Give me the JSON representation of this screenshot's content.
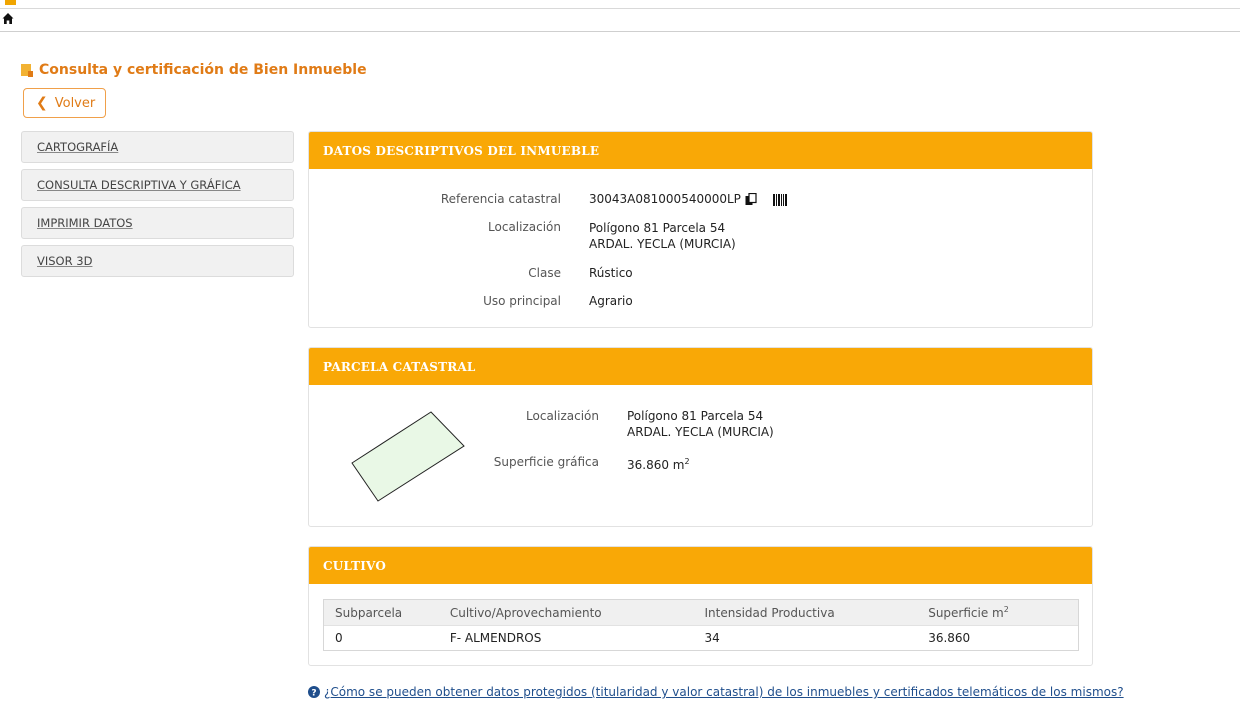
{
  "header": {
    "title": "Consulta y certificación de Bien Inmueble",
    "back_label": "Volver"
  },
  "sidebar": {
    "items": [
      {
        "label": "CARTOGRAFÍA"
      },
      {
        "label": "CONSULTA DESCRIPTIVA Y GRÁFICA"
      },
      {
        "label": "IMPRIMIR DATOS"
      },
      {
        "label": "VISOR 3D"
      }
    ]
  },
  "inmueble": {
    "heading": "DATOS DESCRIPTIVOS DEL INMUEBLE",
    "ref_label": "Referencia catastral",
    "ref_value": "30043A081000540000LP",
    "loc_label": "Localización",
    "loc_line1": "Polígono 81 Parcela 54",
    "loc_line2": "ARDAL. YECLA (MURCIA)",
    "clase_label": "Clase",
    "clase_value": "Rústico",
    "uso_label": "Uso principal",
    "uso_value": "Agrario"
  },
  "parcela": {
    "heading": "PARCELA CATASTRAL",
    "loc_label": "Localización",
    "loc_line1": "Polígono 81 Parcela 54",
    "loc_line2": "ARDAL. YECLA (MURCIA)",
    "sup_label": "Superficie gráfica",
    "sup_value": "36.860 m",
    "sup_unit_sup": "2"
  },
  "cultivo": {
    "heading": "CULTIVO",
    "columns": [
      "Subparcela",
      "Cultivo/Aprovechamiento",
      "Intensidad Productiva",
      "Superficie m"
    ],
    "col4_sup": "2",
    "rows": [
      [
        "0",
        "F- ALMENDROS",
        "34",
        "36.860"
      ]
    ]
  },
  "help_link": "¿Cómo se pueden obtener datos protegidos (titularidad y valor catastral) de los inmuebles y certificados telemáticos de los mismos?",
  "colors": {
    "accent": "#f9a806",
    "title": "#e07b16",
    "link": "#1f4e8c",
    "parcel_fill": "#e9f8e6"
  }
}
